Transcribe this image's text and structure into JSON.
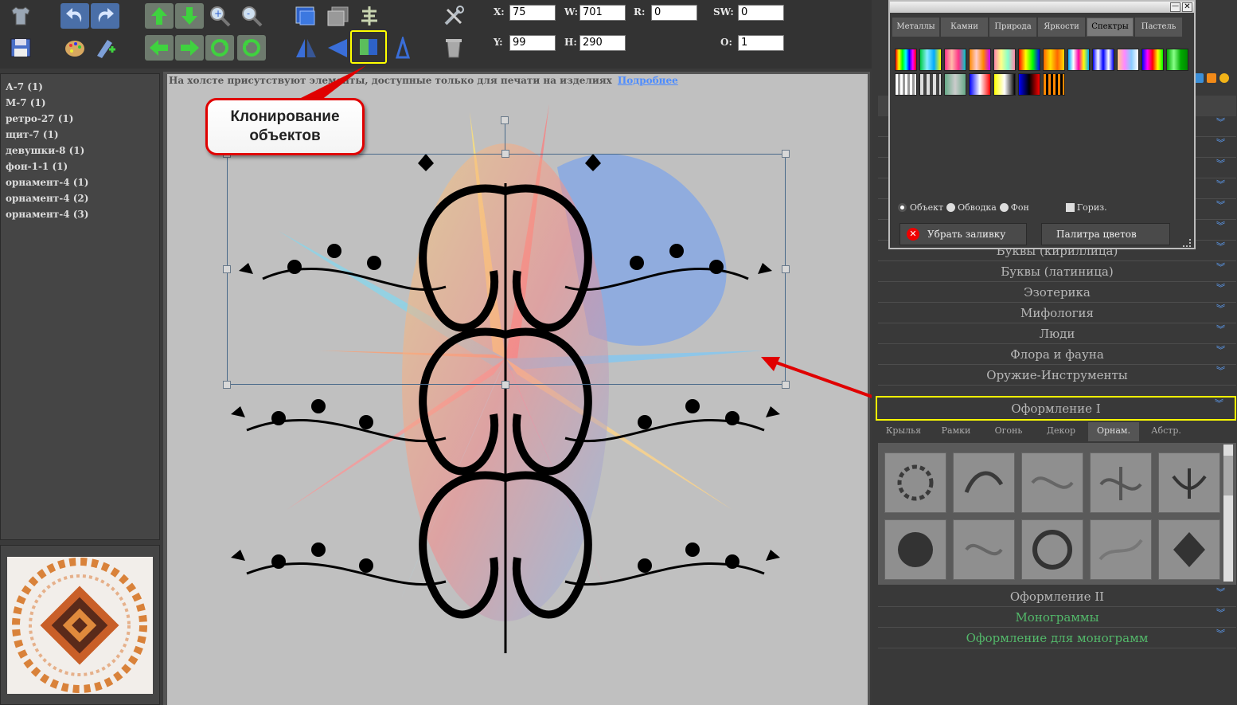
{
  "coords": {
    "x_label": "X:",
    "x_value": "75",
    "y_label": "Y:",
    "y_value": "99",
    "w_label": "W:",
    "w_value": "701",
    "h_label": "H:",
    "h_value": "290",
    "r_label": "R:",
    "r_value": "0",
    "sw_label": "SW:",
    "sw_value": "0",
    "o_label": "O:",
    "o_value": "1"
  },
  "layers": [
    "А-7 (1)",
    "М-7 (1)",
    "ретро-27 (1)",
    "щит-7 (1)",
    "девушки-8 (1)",
    "фон-1-1 (1)",
    "орнамент-4 (1)",
    "орнамент-4 (2)",
    "орнамент-4 (3)"
  ],
  "canvas": {
    "notice": "На холсте присутствуют элементы, доступные только для печати на изделиях",
    "notice_link": "Подробнее"
  },
  "callout": {
    "text": "Клонирование объектов"
  },
  "palette": {
    "tabs": [
      "Металлы",
      "Камни",
      "Природа",
      "Яркости",
      "Спектры",
      "Пастель"
    ],
    "active_tab": "Спектры",
    "radio_object": "Объект",
    "radio_stroke": "Обводка",
    "radio_bg": "Фон",
    "checkbox_horiz": "Гориз.",
    "remove_fill": "Убрать заливку",
    "color_palette": "Палитра цветов"
  },
  "categories": [
    "Буквы (кириллица)",
    "Буквы (латиница)",
    "Эзотерика",
    "Мифология",
    "Люди",
    "Флора и фауна",
    "Оружие-Инструменты",
    "Оформление I"
  ],
  "subtabs": [
    "Крылья",
    "Рамки",
    "Огонь",
    "Декор",
    "Орнам.",
    "Абстр."
  ],
  "active_subtab": "Орнам.",
  "bottom_categories": [
    "Оформление II",
    "Монограммы",
    "Оформление для монограмм"
  ],
  "colors": {
    "accent": "#ffff00",
    "arrow": "#e00000",
    "link": "#4d8cff",
    "green_cat": "#53b86a"
  },
  "icons": {
    "toolbar": [
      "tshirt-icon",
      "undo-icon",
      "redo-icon",
      "move-up-icon",
      "move-down-icon",
      "zoom-in-icon",
      "zoom-out-icon",
      "bring-front-icon",
      "send-back-icon",
      "align-icon",
      "tools-icon",
      "save-icon",
      "paint-palette-icon",
      "add-text-icon",
      "move-left-icon",
      "move-right-icon",
      "rotate-cw-icon",
      "rotate-ccw-icon",
      "flip-horizontal-icon",
      "clone-icon",
      "flip-vertical-icon",
      "trash-icon"
    ]
  }
}
